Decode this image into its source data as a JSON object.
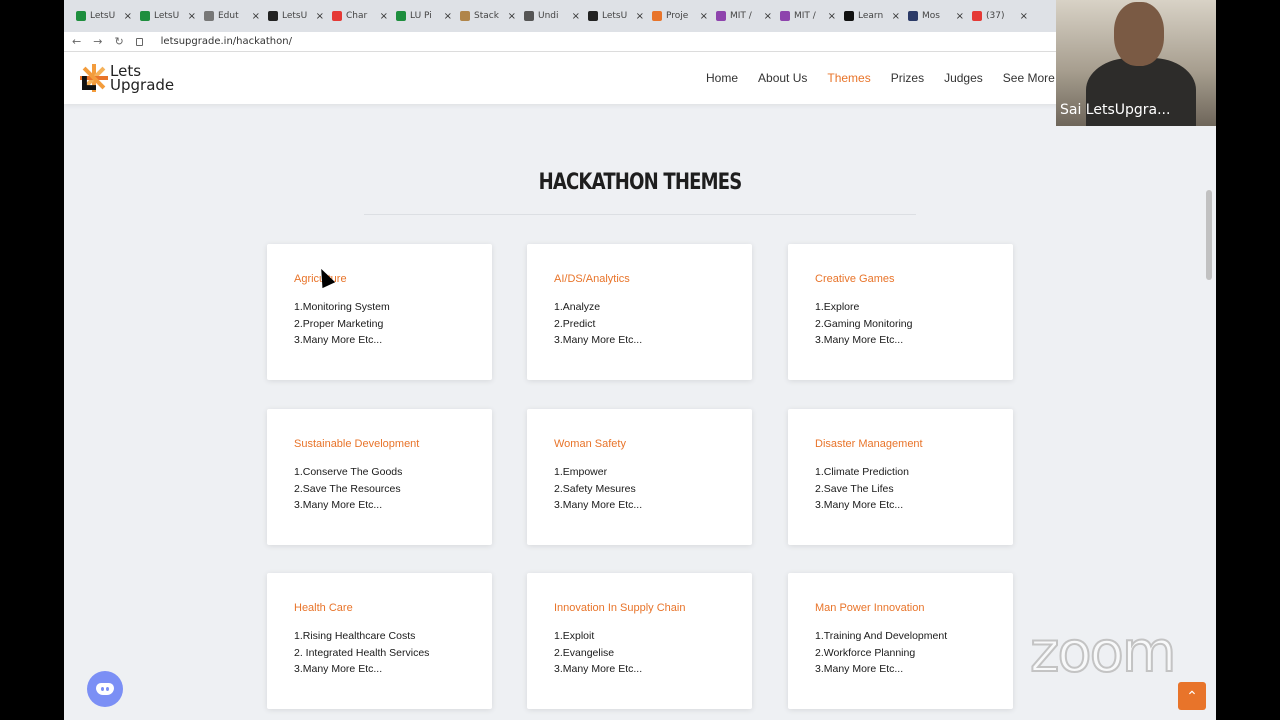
{
  "browser": {
    "tabs": [
      "LetsU",
      "LetsU",
      "Edut",
      "LetsU",
      "Char",
      "LU Pi",
      "Stack",
      "Undi",
      "LetsU",
      "Proje",
      "MIT /",
      "MIT /",
      "Learn",
      "Mos",
      "(37)"
    ],
    "tab_colors": [
      "#1e8e3e",
      "#1e8e3e",
      "#777777",
      "#222222",
      "#e53935",
      "#1e8e3e",
      "#b0854a",
      "#555555",
      "#222222",
      "#e8742a",
      "#8e44ad",
      "#8e44ad",
      "#111111",
      "#2b3a67",
      "#e53935"
    ],
    "url": "letsupgrade.in/hackathon/"
  },
  "site": {
    "logo": {
      "line1": "Lets",
      "line2": "Upgrade"
    },
    "menu": [
      "Home",
      "About Us",
      "Themes",
      "Prizes",
      "Judges",
      "See More"
    ]
  },
  "section_title": "HACKATHON THEMES",
  "themes": [
    {
      "title": "Agriculture",
      "items": [
        "1.Monitoring System",
        "2.Proper Marketing",
        "3.Many More Etc..."
      ]
    },
    {
      "title": "AI/DS/Analytics",
      "items": [
        "1.Analyze",
        "2.Predict",
        "3.Many More Etc..."
      ]
    },
    {
      "title": "Creative Games",
      "items": [
        "1.Explore",
        "2.Gaming Monitoring",
        "3.Many More Etc..."
      ]
    },
    {
      "title": "Sustainable Development",
      "items": [
        "1.Conserve The Goods",
        "2.Save The Resources",
        "3.Many More Etc..."
      ]
    },
    {
      "title": "Woman Safety",
      "items": [
        "1.Empower",
        "2.Safety Mesures",
        "3.Many More Etc..."
      ]
    },
    {
      "title": "Disaster Management",
      "items": [
        "1.Climate Prediction",
        "2.Save The Lifes",
        "3.Many More Etc..."
      ]
    },
    {
      "title": "Health Care",
      "items": [
        "1.Rising Healthcare Costs",
        "2. Integrated Health Services",
        "3.Many More Etc..."
      ]
    },
    {
      "title": "Innovation In Supply Chain",
      "items": [
        "1.Exploit",
        "2.Evangelise",
        "3.Many More Etc..."
      ]
    },
    {
      "title": "Man Power Innovation",
      "items": [
        "1.Training And Development",
        "2.Workforce Planning",
        "3.Many More Etc..."
      ]
    }
  ],
  "video": {
    "name": "Sai LetsUpgra..."
  },
  "zoom_watermark": "zoom",
  "accent_color": "#e8742a"
}
